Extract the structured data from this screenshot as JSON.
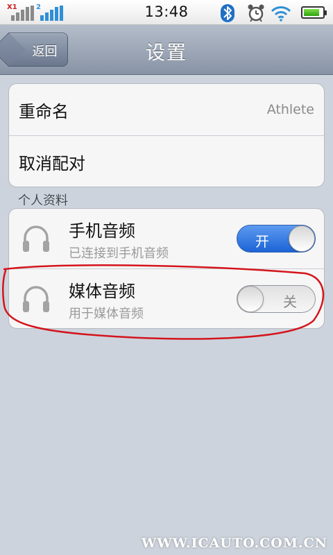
{
  "status_bar": {
    "sim1_tag": "X1",
    "sim2_tag": "2",
    "time": "13:48",
    "battery_level": 0.85,
    "icons": [
      "signal-icon",
      "signal-icon",
      "bluetooth-icon",
      "alarm-icon",
      "wifi-icon",
      "battery-icon"
    ]
  },
  "nav": {
    "back_label": "返回",
    "title": "设置"
  },
  "device_group": {
    "rename_label": "重命名",
    "device_name": "Athlete",
    "unpair_label": "取消配对"
  },
  "profiles": {
    "header": "个人资料",
    "items": [
      {
        "name": "手机音频",
        "subtitle": "已连接到手机音频",
        "switch_on": true,
        "switch_label": "开"
      },
      {
        "name": "媒体音频",
        "subtitle": "用于媒体音频",
        "switch_on": false,
        "switch_label": "关"
      }
    ]
  },
  "colors": {
    "accent_blue": "#1d63d6",
    "annotation_red": "#d4141c",
    "background": "#cdd3dc"
  },
  "watermark": "WWW.ICAUTO.COM.CN"
}
